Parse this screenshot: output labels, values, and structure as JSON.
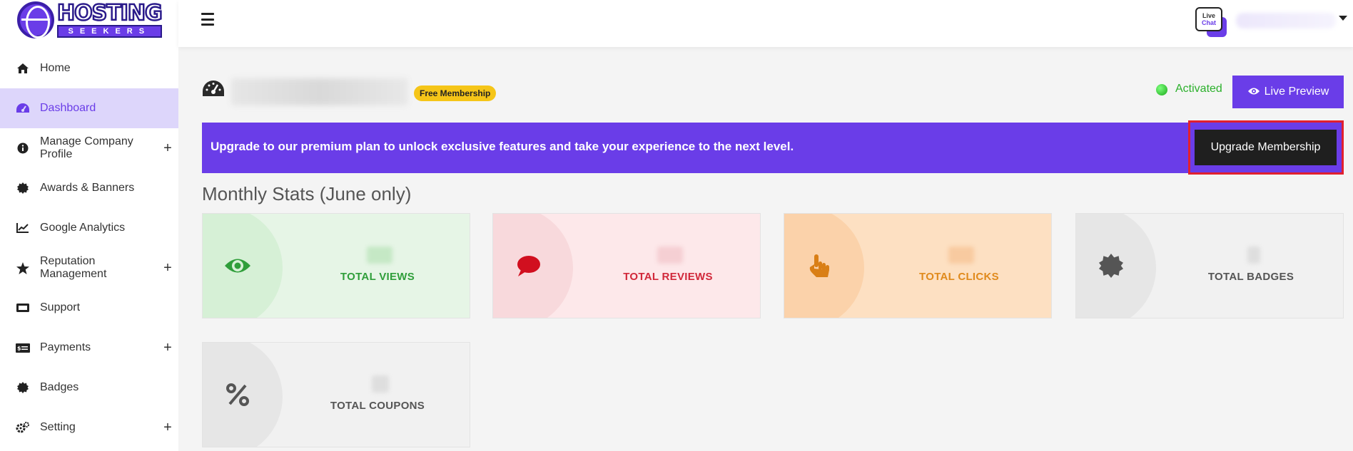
{
  "brand": {
    "logo_main": "HOSTING",
    "logo_sub": "SEEKERS"
  },
  "sidebar": {
    "items": [
      {
        "label": "Home",
        "icon": "home-icon",
        "expandable": false
      },
      {
        "label": "Dashboard",
        "icon": "gauge-icon",
        "expandable": false,
        "active": true
      },
      {
        "label": "Manage Company Profile",
        "icon": "info-icon",
        "expandable": true
      },
      {
        "label": "Awards & Banners",
        "icon": "certificate-icon",
        "expandable": false
      },
      {
        "label": "Google Analytics",
        "icon": "line-chart-icon",
        "expandable": false
      },
      {
        "label": "Reputation Management",
        "icon": "star-icon",
        "expandable": true
      },
      {
        "label": "Support",
        "icon": "ticket-icon",
        "expandable": false
      },
      {
        "label": "Payments",
        "icon": "money-icon",
        "expandable": true
      },
      {
        "label": "Badges",
        "icon": "certificate-icon",
        "expandable": false
      },
      {
        "label": "Setting",
        "icon": "gears-icon",
        "expandable": true
      }
    ],
    "expand_symbol": "+"
  },
  "topbar": {
    "livechat_line1": "Live",
    "livechat_line2": "Chat"
  },
  "header": {
    "membership_badge": "Free Membership",
    "status": "Activated",
    "live_preview_label": "Live Preview"
  },
  "banner": {
    "text": "Upgrade to our premium plan to unlock exclusive features and take your experience to the next level.",
    "button_label": "Upgrade Membership"
  },
  "stats": {
    "title": "Monthly Stats (June only)",
    "cards": [
      {
        "label": "TOTAL VIEWS",
        "icon": "eye-icon",
        "color": "#2f9e3a"
      },
      {
        "label": "TOTAL REVIEWS",
        "icon": "comment-icon",
        "color": "#d1283a"
      },
      {
        "label": "TOTAL CLICKS",
        "icon": "pointer-hand-icon",
        "color": "#e08a1c"
      },
      {
        "label": "TOTAL BADGES",
        "icon": "certificate-icon",
        "color": "#555555"
      },
      {
        "label": "TOTAL COUPONS",
        "icon": "percent-icon",
        "color": "#555555"
      }
    ]
  },
  "colors": {
    "accent": "#6a3de8",
    "active_bg": "#ddd6fb",
    "highlight_outline": "#e1202f"
  }
}
